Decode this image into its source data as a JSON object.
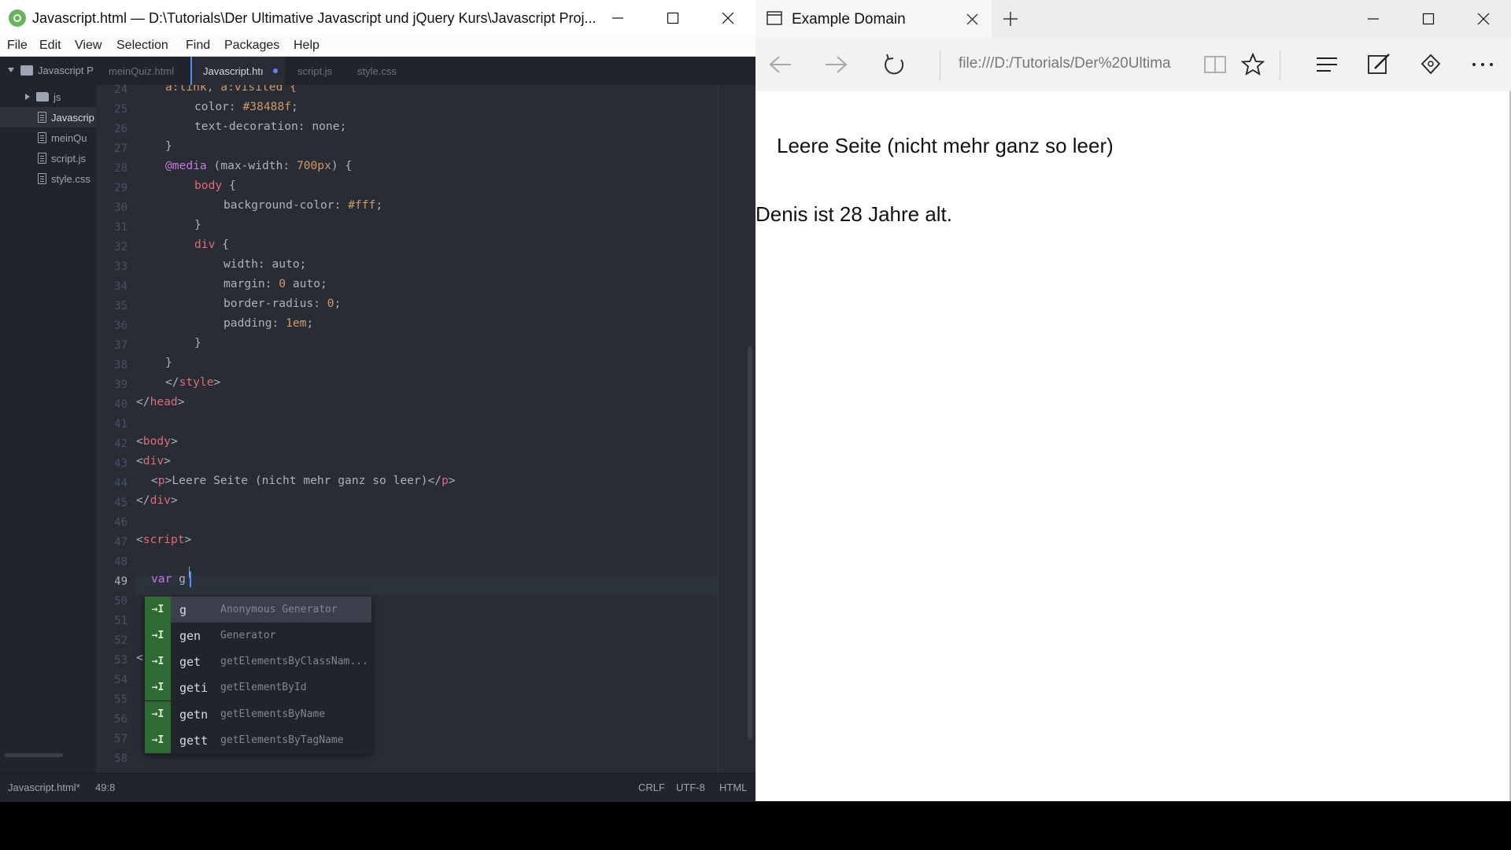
{
  "atom": {
    "title": "Javascript.html — D:\\Tutorials\\Der Ultimative Javascript und jQuery Kurs\\Javascript Proj...",
    "menu": [
      "File",
      "Edit",
      "View",
      "Selection",
      "Find",
      "Packages",
      "Help"
    ],
    "tree": {
      "project": "Javascript P",
      "folder": "js",
      "files": [
        "Javascrip",
        "meinQu",
        "script.js",
        "style.css"
      ]
    },
    "tabs": [
      "meinQuiz.html",
      "Javascript.htı",
      "script.js",
      "style.css"
    ],
    "line_numbers": [
      "24",
      "25",
      "26",
      "27",
      "28",
      "29",
      "30",
      "31",
      "32",
      "33",
      "34",
      "35",
      "36",
      "37",
      "38",
      "39",
      "40",
      "41",
      "42",
      "43",
      "44",
      "45",
      "46",
      "47",
      "48",
      "49",
      "50",
      "51",
      "52",
      "53",
      "54",
      "55",
      "56",
      "57",
      "58"
    ],
    "code": {
      "l24": "a:link, a:visited {",
      "l25a": "color: ",
      "l25b": "#38488f",
      "l25c": ";",
      "l26": "text-decoration: none;",
      "l27": "}",
      "l28a": "@media",
      "l28b": " (max-width: ",
      "l28c": "700px",
      "l28d": ") {",
      "l29a": "body",
      "l29b": " {",
      "l30a": "background-color: ",
      "l30b": "#fff",
      "l30c": ";",
      "l31": "}",
      "l32a": "div",
      "l32b": " {",
      "l33": "width: auto;",
      "l34a": "margin: ",
      "l34b": "0",
      "l34c": " auto;",
      "l35a": "border-radius: ",
      "l35b": "0",
      "l35c": ";",
      "l36a": "padding: ",
      "l36b": "1em",
      "l36c": ";",
      "l37": "}",
      "l38": "}",
      "l39a": "</",
      "l39b": "style",
      "l39c": ">",
      "l40a": "</",
      "l40b": "head",
      "l40c": ">",
      "l42a": "<",
      "l42b": "body",
      "l42c": ">",
      "l43a": "<",
      "l43b": "div",
      "l43c": ">",
      "l44a": "<",
      "l44b": "p",
      "l44c": ">",
      "l44d": "Leere Seite (nicht mehr ganz so leer)",
      "l44e": "</",
      "l44f": "p",
      "l44g": ">",
      "l45a": "</",
      "l45b": "div",
      "l45c": ">",
      "l47a": "<",
      "l47b": "script",
      "l47c": ">",
      "l49a": "var",
      "l49b": " g",
      "l53": "<"
    },
    "autocomplete": [
      {
        "icon": "→I",
        "word": "g",
        "desc": "Anonymous Generator"
      },
      {
        "icon": "→I",
        "word": "gen",
        "desc": "Generator"
      },
      {
        "icon": "→I",
        "word": "get",
        "desc": "getElementsByClassNam..."
      },
      {
        "icon": "→I",
        "word": "geti",
        "desc": "getElementById"
      },
      {
        "icon": "→I",
        "word": "getn",
        "desc": "getElementsByName"
      },
      {
        "icon": "→I",
        "word": "gett",
        "desc": "getElementsByTagName"
      }
    ],
    "status": {
      "file": "Javascript.html*",
      "cursor": "49:8",
      "line_ending": "CRLF",
      "encoding": "UTF-8",
      "grammar": "HTML"
    }
  },
  "browser": {
    "tab_title": "Example Domain",
    "url": "file:///D:/Tutorials/Der%20Ultima",
    "content": {
      "p1": "Leere Seite (nicht mehr ganz so leer)",
      "p2": "Denis ist 28 Jahre alt."
    }
  },
  "colors": {
    "accent": "#568af2",
    "editor_bg": "#282c34",
    "tag": "#e06c75",
    "value": "#d19a66",
    "keyword": "#c678dd"
  }
}
